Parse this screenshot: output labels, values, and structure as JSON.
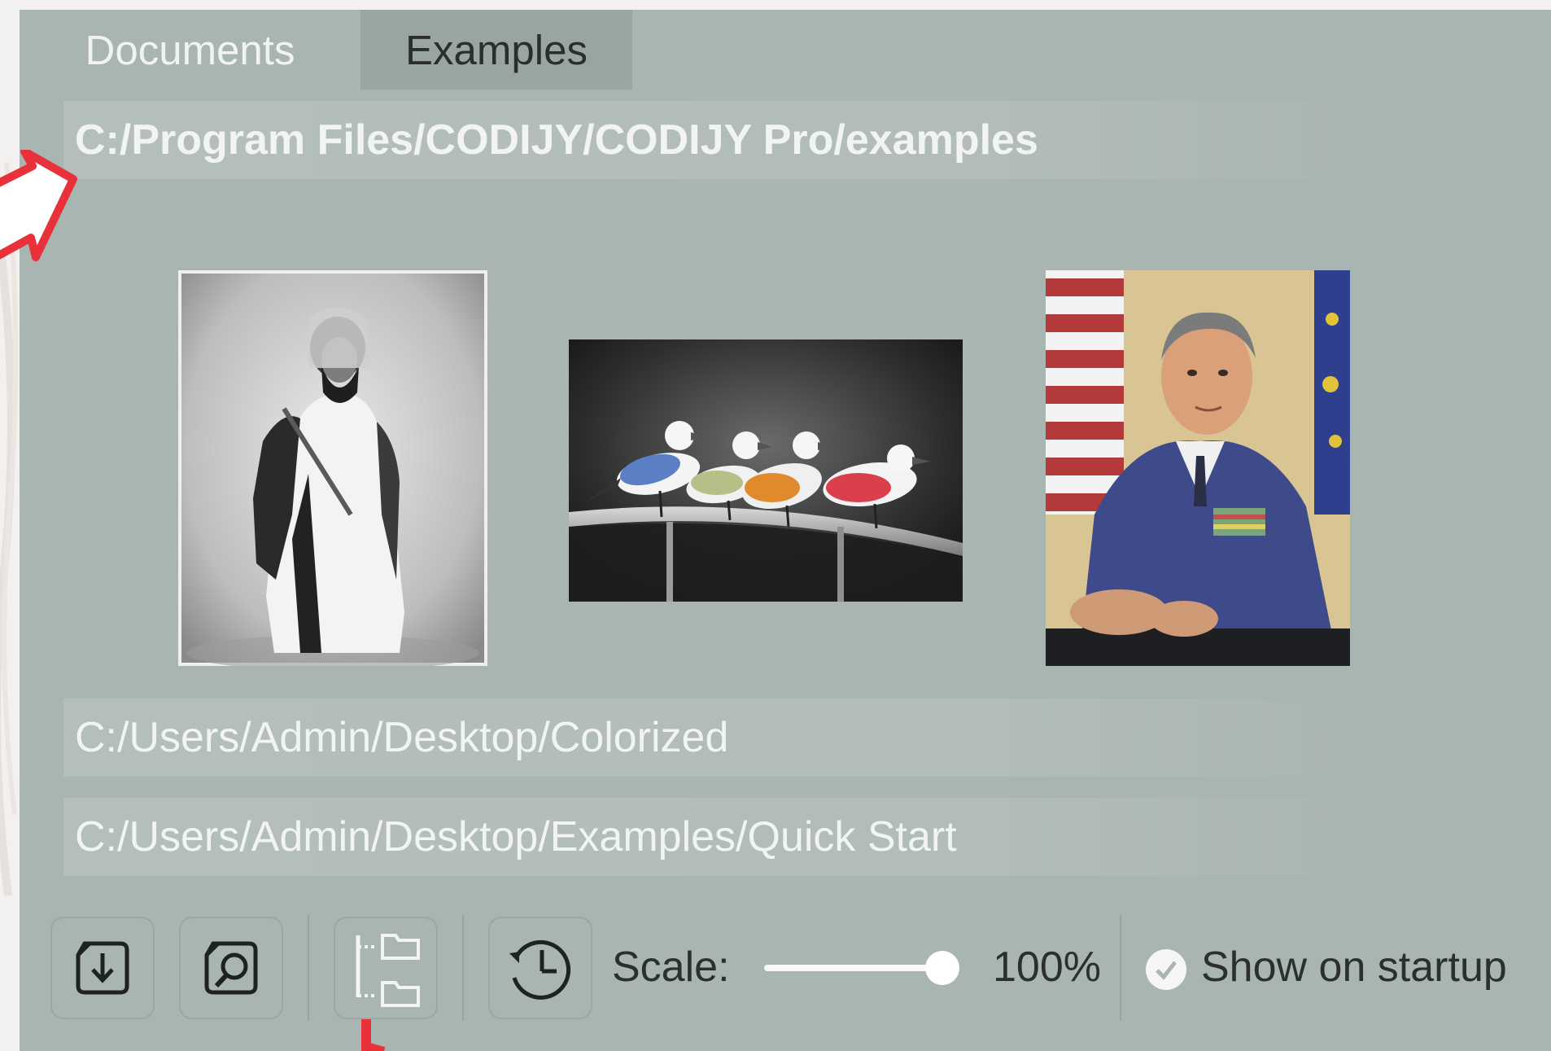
{
  "tabs": [
    {
      "label": "Documents",
      "active": false
    },
    {
      "label": "Examples",
      "active": true
    }
  ],
  "examples_path": "C:/Program Files/CODIJY/CODIJY Pro/examples",
  "thumbnails": [
    {
      "name": "bedouin-portrait",
      "kind": "black-and-white photo"
    },
    {
      "name": "colorized-birds",
      "kind": "color photo"
    },
    {
      "name": "officer-portrait",
      "kind": "color photo"
    }
  ],
  "output_path": "C:/Users/Admin/Desktop/Colorized",
  "quickstart_path": "C:/Users/Admin/Desktop/Examples/Quick Start",
  "toolbar": {
    "buttons": [
      {
        "icon": "import-icon"
      },
      {
        "icon": "browse-icon"
      },
      {
        "icon": "folder-tree-icon"
      },
      {
        "icon": "history-icon"
      }
    ],
    "scale_label": "Scale:",
    "scale_value": "100%",
    "scale_fraction": 1.0,
    "show_on_startup_label": "Show on startup",
    "show_on_startup_checked": true
  },
  "colors": {
    "panel": "#a9b5b0",
    "active_tab": "#98a5a1",
    "annotation_red": "#e8313a"
  }
}
